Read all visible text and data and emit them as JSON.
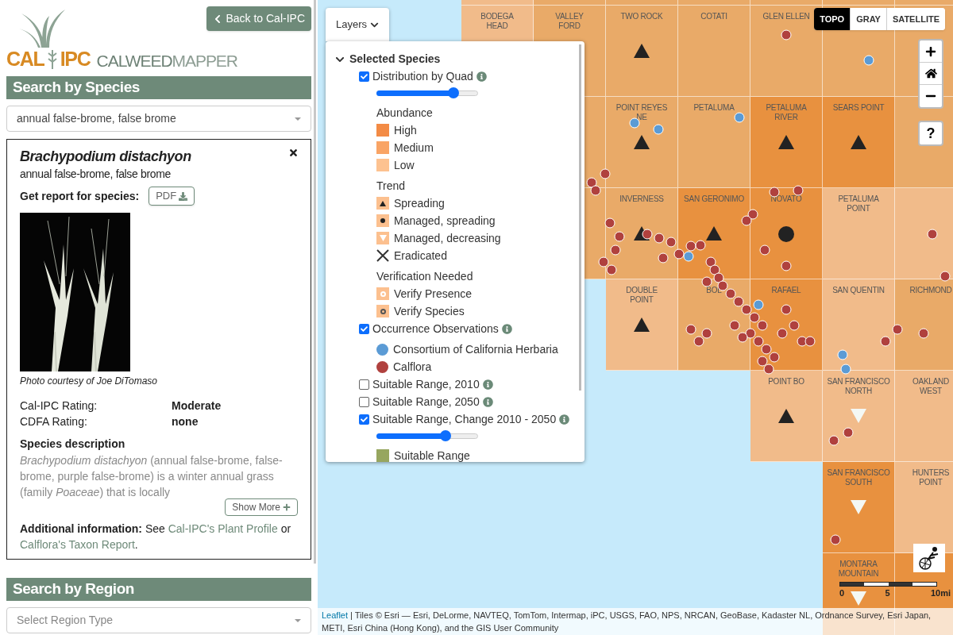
{
  "sidebar": {
    "back_button": "Back to Cal-IPC",
    "logo": {
      "org_left": "CAL",
      "org_right": "IPC",
      "product_a": "CALWEED",
      "product_b": "MAPPER"
    }
  },
  "species_search": {
    "title": "Search by Species",
    "value": "annual false-brome, false brome"
  },
  "species_card": {
    "scientific_name": "Brachypodium distachyon",
    "common_name": "annual false-brome, false brome",
    "report_label": "Get report for species:",
    "report_button": "PDF",
    "photo_credit": "Photo courtesy of Joe DiTomaso",
    "ratings": [
      {
        "label": "Cal-IPC Rating:",
        "value": "Moderate"
      },
      {
        "label": "CDFA Rating:",
        "value": "none"
      }
    ],
    "description_title": "Species description",
    "description": "*Brachypodium distachyon* (annual false-brome, false-brome, purple false-brome) is a winter annual grass (family *Poaceae*) that is locally",
    "show_more": "Show More",
    "additional": {
      "label": "Additional information:",
      "text_a": "See",
      "link_a": "Cal-IPC's Plant Profile",
      "text_b": "or",
      "link_b": "Calflora's Taxon Report",
      "text_c": "."
    }
  },
  "region_search": {
    "title": "Search by Region",
    "placeholder": "Select Region Type"
  },
  "map": {
    "layers_button": "Layers",
    "help_button": "?",
    "basemaps": [
      {
        "label": "TOPO",
        "selected": true
      },
      {
        "label": "GRAY",
        "selected": false
      },
      {
        "label": "SATELLITE",
        "selected": false
      }
    ],
    "scale_labels": [
      "0",
      "5",
      "10mi"
    ],
    "attribution": {
      "link": "Leaflet",
      "text": "| Tiles © Esri — Esri, DeLorme, NAVTEQ, TomTom, Intermap, iPC, USGS, FAO, NPS, NRCAN, GeoBase, Kadaster NL, Ordnance Survey, Esri Japan, METI, Esri China (Hong Kong), and the GIS User Community"
    },
    "quad_rows": [
      [
        {
          "kind": "water"
        },
        {
          "kind": "low"
        },
        {
          "kind": "medium"
        },
        {
          "kind": "medium"
        },
        {
          "kind": "medium"
        },
        {
          "kind": "medium"
        },
        {
          "kind": "medium"
        },
        {
          "kind": "medium"
        }
      ],
      [
        {
          "kind": "water"
        },
        {
          "kind": "low",
          "label": "BODEGA\nHEAD"
        },
        {
          "kind": "medium",
          "label": "VALLEY\nFORD"
        },
        {
          "kind": "medium",
          "label": "TWO ROCK",
          "marker": {
            "kind": "spreading"
          }
        },
        {
          "kind": "medium",
          "label": "COTATI"
        },
        {
          "kind": "medium",
          "label": "GLEN ELLEN"
        },
        {
          "kind": "medium"
        },
        {
          "kind": "medium"
        }
      ],
      [
        {
          "kind": "water"
        },
        {
          "kind": "water"
        },
        {
          "kind": "medium"
        },
        {
          "kind": "medium",
          "label": "POINT REYES\nNE",
          "marker": {
            "kind": "spreading"
          }
        },
        {
          "kind": "medium",
          "label": "PETALUMA"
        },
        {
          "kind": "high",
          "label": "PETALUMA\nRIVER",
          "marker": {
            "kind": "spreading"
          }
        },
        {
          "kind": "high",
          "label": "SEARS POINT",
          "marker": {
            "kind": "spreading"
          }
        },
        {
          "kind": "medium"
        }
      ],
      [
        {
          "kind": "water"
        },
        {
          "kind": "water"
        },
        {
          "kind": "medium"
        },
        {
          "kind": "medium",
          "label": "INVERNESS",
          "marker": {
            "kind": "spreading"
          }
        },
        {
          "kind": "high",
          "label": "SAN GERONIMO",
          "marker": {
            "kind": "spreading"
          }
        },
        {
          "kind": "high",
          "label": "NOVATO",
          "marker": {
            "kind": "managed-spreading"
          }
        },
        {
          "kind": "low",
          "label": "PETALUMA\nPOINT"
        },
        {
          "kind": "low"
        }
      ],
      [
        {
          "kind": "water"
        },
        {
          "kind": "water"
        },
        {
          "kind": "water"
        },
        {
          "kind": "low",
          "label": "DOUBLE\nPOINT",
          "marker": {
            "kind": "spreading"
          }
        },
        {
          "kind": "medium",
          "label": "BOL"
        },
        {
          "kind": "high",
          "label": "RAFAEL"
        },
        {
          "kind": "low",
          "label": "SAN QUENTIN"
        },
        {
          "kind": "medium",
          "label": "RICHMOND"
        }
      ],
      [
        {
          "kind": "water"
        },
        {
          "kind": "water"
        },
        {
          "kind": "water"
        },
        {
          "kind": "water"
        },
        {
          "kind": "water"
        },
        {
          "kind": "low",
          "label": "POINT BO",
          "marker": {
            "kind": "spreading"
          }
        },
        {
          "kind": "low",
          "label": "SAN FRANCISCO\nNORTH",
          "marker": {
            "kind": "managed-decreasing"
          }
        },
        {
          "kind": "low",
          "label": "OAKLAND\nWEST"
        }
      ],
      [
        {
          "kind": "water"
        },
        {
          "kind": "water"
        },
        {
          "kind": "water"
        },
        {
          "kind": "water"
        },
        {
          "kind": "water"
        },
        {
          "kind": "water"
        },
        {
          "kind": "high",
          "label": "SAN FRANCISCO\nSOUTH",
          "marker": {
            "kind": "managed-decreasing"
          }
        },
        {
          "kind": "low",
          "label": "HUNTERS\nPOINT"
        }
      ],
      [
        {
          "kind": "water"
        },
        {
          "kind": "water"
        },
        {
          "kind": "water"
        },
        {
          "kind": "water"
        },
        {
          "kind": "water"
        },
        {
          "kind": "water"
        },
        {
          "kind": "high",
          "label": "MONTARA\nMOUNTAIN",
          "marker": {
            "kind": "managed-decreasing"
          }
        },
        {
          "kind": "high"
        }
      ]
    ]
  },
  "layers_panel": {
    "group": {
      "title": "Selected Species",
      "expanded": true
    },
    "layers": [
      {
        "label": "Distribution by Quad",
        "checked": true,
        "info": true,
        "level": 0.76,
        "legend": [
          {
            "title": "Abundance",
            "entries": [
              {
                "kind": "swatch",
                "color": "#f38b45",
                "label": "High"
              },
              {
                "kind": "swatch",
                "color": "#f9a465",
                "label": "Medium"
              },
              {
                "kind": "swatch",
                "color": "#fdc290",
                "label": "Low"
              }
            ]
          },
          {
            "title": "Trend",
            "entries": [
              {
                "kind": "spreading",
                "label": "Spreading"
              },
              {
                "kind": "managed-spreading",
                "label": "Managed, spreading"
              },
              {
                "kind": "managed-decreasing",
                "label": "Managed, decreasing"
              },
              {
                "kind": "eradicated",
                "label": "Eradicated"
              }
            ]
          },
          {
            "title": "Verification Needed",
            "entries": [
              {
                "kind": "verify-presence",
                "label": "Verify Presence"
              },
              {
                "kind": "verify-species",
                "label": "Verify Species"
              }
            ]
          }
        ]
      },
      {
        "label": "Occurrence Observations",
        "checked": true,
        "info": true,
        "legend": [
          {
            "entries": [
              {
                "kind": "dot",
                "color": "#5b9bd5",
                "label": "Consortium of California Herbaria"
              },
              {
                "kind": "dot",
                "color": "#b0413e",
                "label": "Calflora"
              }
            ]
          }
        ]
      },
      {
        "label": "Suitable Range, 2010",
        "checked": false,
        "info": true
      },
      {
        "label": "Suitable Range, 2050",
        "checked": false,
        "info": true
      },
      {
        "label": "Suitable Range, Change 2010 - 2050",
        "checked": true,
        "info": true,
        "level": 0.68,
        "legend": [
          {
            "entries": [
              {
                "kind": "swatch",
                "color": "#97a65f",
                "label": "Suitable Range"
              }
            ]
          }
        ]
      }
    ]
  }
}
